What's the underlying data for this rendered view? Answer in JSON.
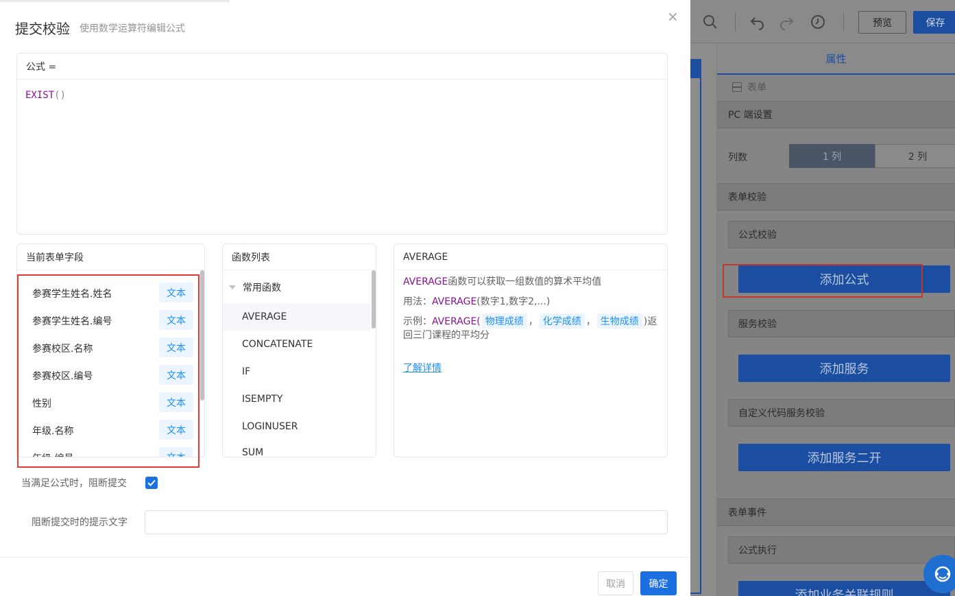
{
  "toolbar": {
    "preview_label": "预览",
    "save_label": "保存"
  },
  "panel": {
    "tab": "属性",
    "form_crumb": "表单",
    "pc_section": "PC 端设置",
    "columns_label": "列数",
    "columns_options": [
      "1 列",
      "2 列"
    ],
    "form_validation_section": "表单校验",
    "formula_validation": "公式校验",
    "add_formula": "添加公式",
    "service_validation": "服务校验",
    "add_service": "添加服务",
    "custom_code_validation": "自定义代码服务校验",
    "add_service_dev": "添加服务二开",
    "form_events_section": "表单事件",
    "formula_exec": "公式执行",
    "add_business_rule": "添加业务关联规则"
  },
  "dialog": {
    "title": "提交校验",
    "subtitle": "使用数学运算符编辑公式",
    "close_glyph": "×",
    "formula_label": "公式 =",
    "formula_fn": "EXIST",
    "formula_parens": "()",
    "fields_title": "当前表单字段",
    "fields": [
      {
        "name": "参赛学生姓名.姓名",
        "type": "文本"
      },
      {
        "name": "参赛学生姓名.编号",
        "type": "文本"
      },
      {
        "name": "参赛校区.名称",
        "type": "文本"
      },
      {
        "name": "参赛校区.编号",
        "type": "文本"
      },
      {
        "name": "性别",
        "type": "文本"
      },
      {
        "name": "年级.名称",
        "type": "文本"
      },
      {
        "name": "年级.编号",
        "type": "文本"
      }
    ],
    "functions_title": "函数列表",
    "function_group": "常用函数",
    "functions": [
      "AVERAGE",
      "CONCATENATE",
      "IF",
      "ISEMPTY",
      "LOGINUSER",
      "SUM"
    ],
    "desc_title": "AVERAGE",
    "desc_line1_fn": "AVERAGE",
    "desc_line1_text": "函数可以获取一组数值的算术平均值",
    "usage_label": "用法：",
    "usage_fn": "AVERAGE",
    "usage_args": "(数字1,数字2,...)",
    "example_label": "示例：",
    "example_fn": "AVERAGE(",
    "example_chips": [
      "物理成绩",
      "化学成绩",
      "生物成绩"
    ],
    "example_sep": "，",
    "example_tail": ")返",
    "example_line2": "回三门课程的平均分",
    "learn_more": "了解详情",
    "block_submit_label": "当满足公式时，阻断提交",
    "block_submit_checked": true,
    "hint_label": "阻断提交时的提示文字",
    "hint_value": "",
    "cancel_label": "取消",
    "ok_label": "确定"
  }
}
